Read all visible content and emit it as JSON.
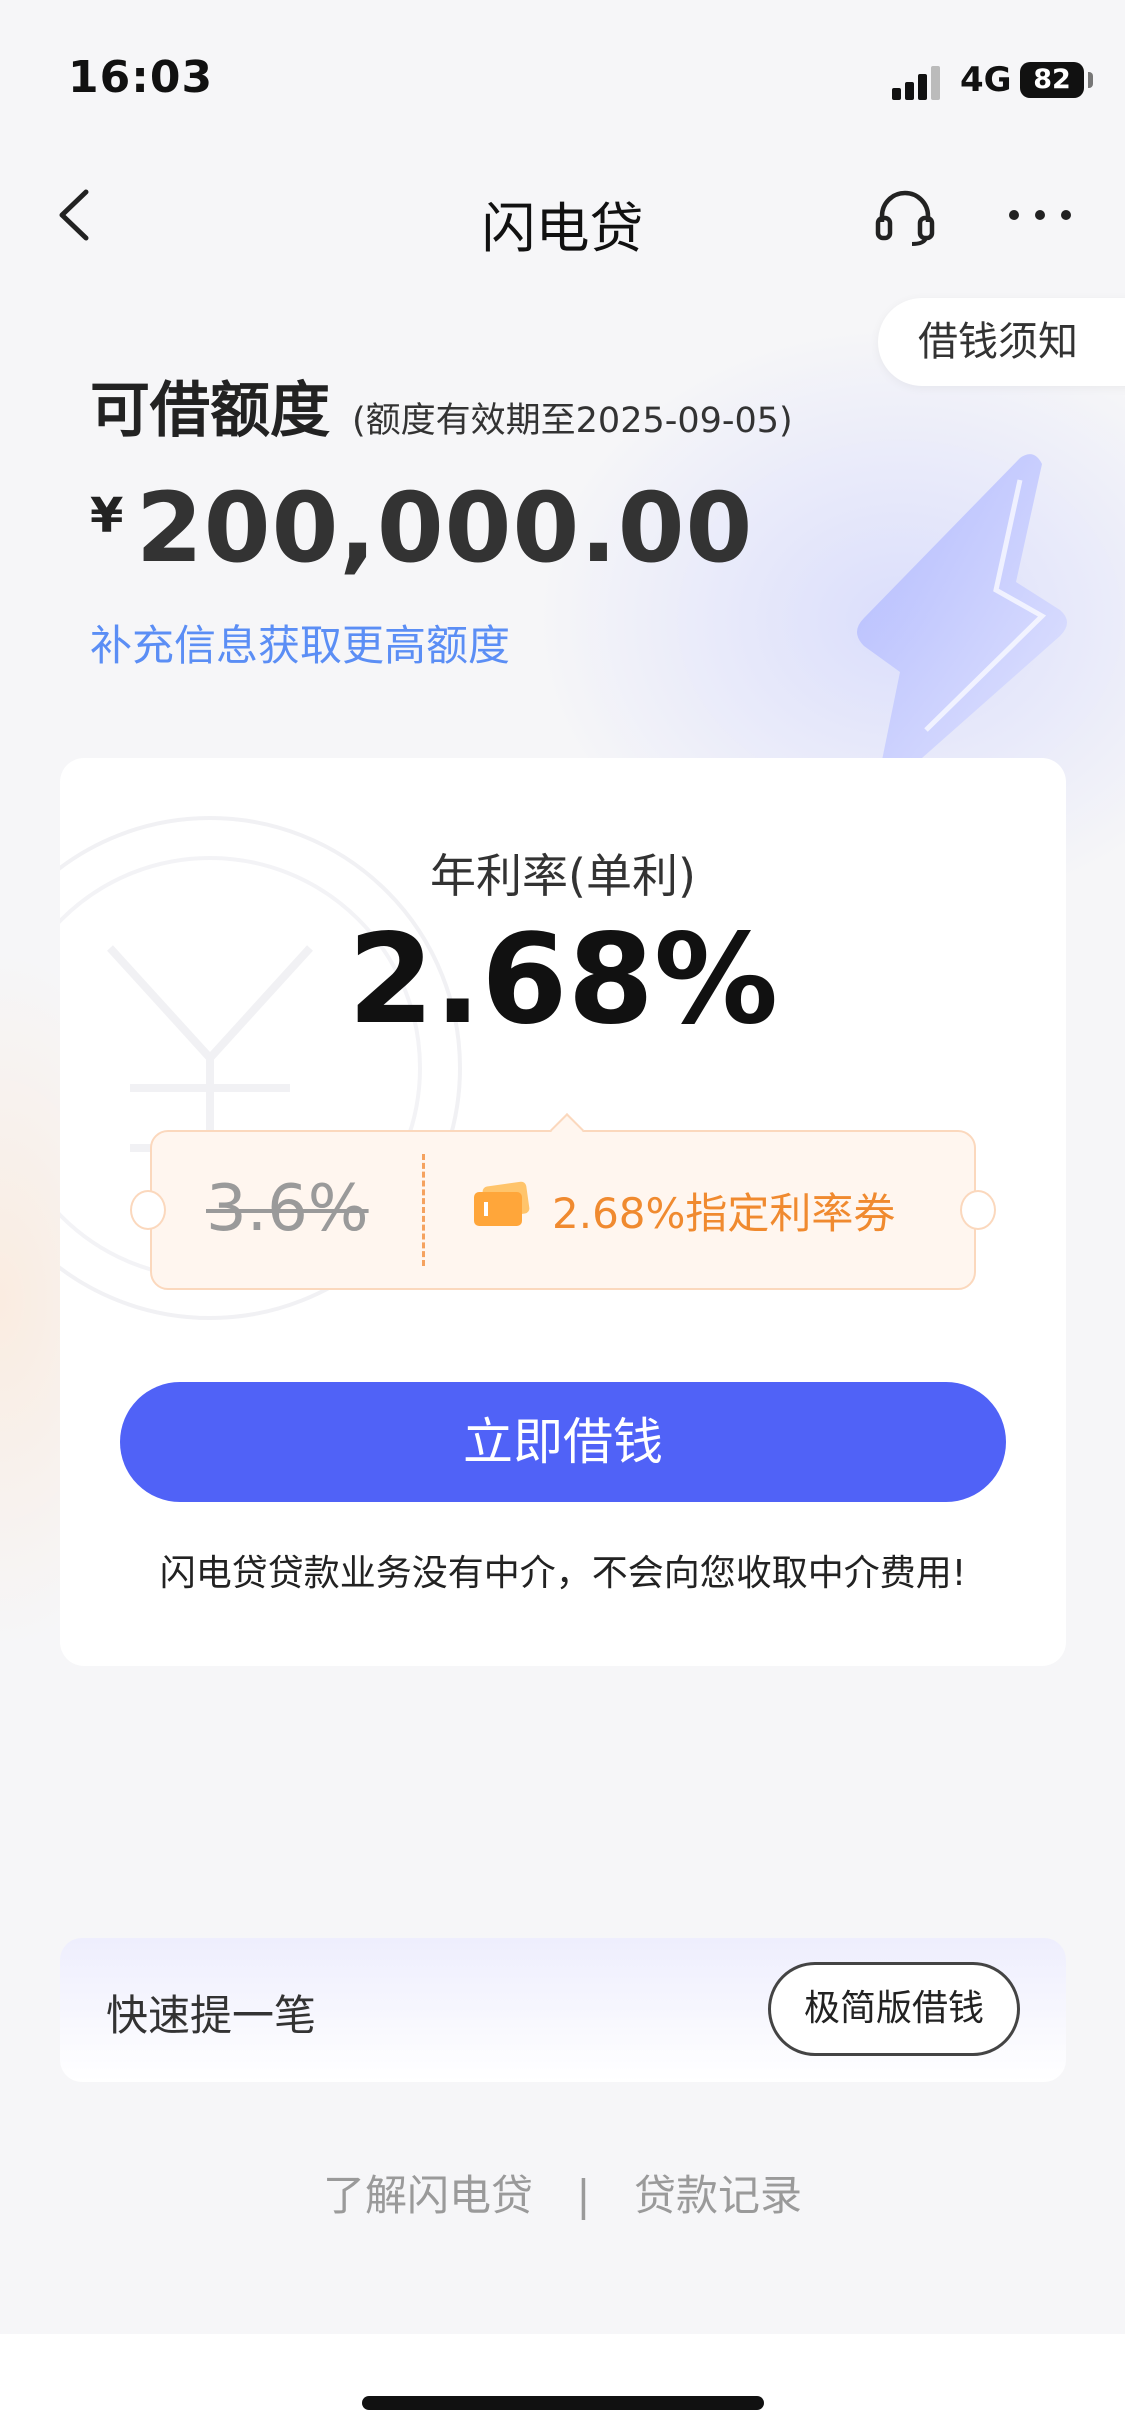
{
  "status_bar": {
    "time": "16:03",
    "network": "4G",
    "battery": "82"
  },
  "nav": {
    "title": "闪电贷"
  },
  "notice_button": "借钱须知",
  "limit": {
    "label": "可借额度",
    "validity": "(额度有效期至2025-09-05)",
    "currency": "¥",
    "amount": "200,000.00",
    "more_link": "补充信息获取更高额度"
  },
  "rate": {
    "label": "年利率(单利)",
    "value": "2.68%",
    "original": "3.6%",
    "coupon_text": "2.68%指定利率券"
  },
  "borrow_button": "立即借钱",
  "disclaimer": "闪电贷贷款业务没有中介，不会向您收取中介费用!",
  "quick": {
    "title": "快速提一笔",
    "button": "极简版借钱"
  },
  "footer": {
    "link1": "了解闪电贷",
    "separator": "|",
    "link2": "贷款记录"
  },
  "colors": {
    "primary": "#5062f7",
    "link": "#5b8ef5",
    "coupon": "#f08a2f"
  }
}
